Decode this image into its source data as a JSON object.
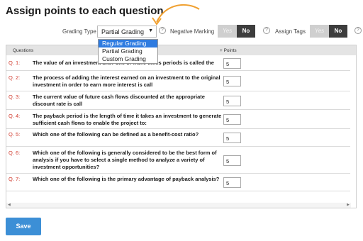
{
  "page_title": "Assign points to each question",
  "options": {
    "grading_type_label": "Grading Type",
    "grading_type_value": "Partial Grading",
    "negative_marking_label": "Negative Marking",
    "assign_tags_label": "Assign Tags",
    "toggle_yes": "Yes",
    "toggle_no": "No"
  },
  "dropdown": {
    "options": [
      "Regular Grading",
      "Partial Grading",
      "Custom Grading"
    ],
    "highlighted": "Regular Grading"
  },
  "table": {
    "col_questions": "Questions",
    "col_points": "+ Points",
    "rows": [
      {
        "num": "Q. 1:",
        "text": "The value of an investment after one or more times periods is called the",
        "points": "5"
      },
      {
        "num": "Q. 2:",
        "text": "The process of adding the interest earned on an investment to the original investment in order to earn more interest is call",
        "points": "5"
      },
      {
        "num": "Q. 3:",
        "text": "The current value of future cash flows discounted at the appropriate discount rate is call",
        "points": "5"
      },
      {
        "num": "Q. 4:",
        "text": "The payback period is the length of time it takes an investment to generate sufficient cash flows to enable the project to:",
        "points": "5"
      },
      {
        "num": "Q. 5:",
        "text": "Which one of the following can be defined as a benefit-cost ratio?",
        "points": "5"
      },
      {
        "num": "Q. 6:",
        "text": "Which one of the following is generally considered to be the best form of analysis if you have to select a single method to analyze a variety of investment opportunities?",
        "points": "5"
      },
      {
        "num": "Q. 7:",
        "text": "Which one of the following is the primary advantage of payback analysis?",
        "points": "5"
      }
    ]
  },
  "save_label": "Save",
  "colors": {
    "accent": "#3c8fd6",
    "question_number": "#d0382b",
    "dropdown_highlight": "#2e7be0",
    "arrow": "#f0a030"
  }
}
